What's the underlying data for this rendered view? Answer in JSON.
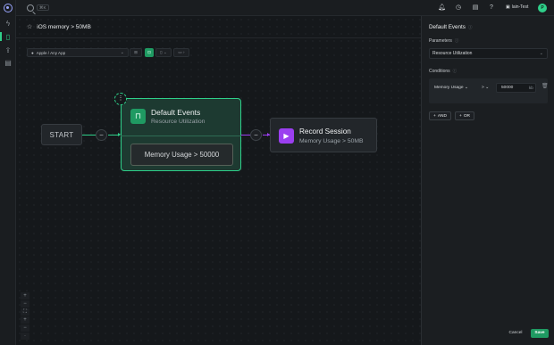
{
  "topbar": {
    "shortcut": "⌘K",
    "user_name": "lain-Test",
    "avatar_initial": "P",
    "icons": [
      "bell-icon",
      "clock-icon",
      "book-icon",
      "help-icon",
      "folder-icon"
    ]
  },
  "rail": {
    "items": [
      "lightning-icon",
      "device-icon",
      "upload-icon",
      "archive-icon"
    ],
    "active": "device-icon"
  },
  "header": {
    "title": "iOS memory > 50MB"
  },
  "toolbar": {
    "platform_label": "Apple / Any App",
    "tool_icons": [
      "grid-icon",
      "code-icon",
      "device-toggle-icon",
      "video-icon"
    ]
  },
  "flow": {
    "start_label": "START",
    "menu_label": "⋮",
    "default_node": {
      "title": "Default Events",
      "subtitle": "Resource Utilization",
      "condition": "Memory Usage > 50000"
    },
    "record_node": {
      "title": "Record Session",
      "subtitle": "Memory Usage > 50MB"
    },
    "connector_symbol": "−"
  },
  "zoom": {
    "controls": [
      "+",
      "−",
      "⛶",
      "+",
      "−",
      "·"
    ]
  },
  "panel": {
    "title": "Default Events",
    "parameters_label": "Parameters",
    "parameters_value": "Resource Utilization",
    "conditions_label": "Conditions",
    "condition": {
      "metric": "Memory Usage",
      "operator": ">",
      "value": "50000",
      "unit": "kb"
    },
    "and_label": "AND",
    "or_label": "OR",
    "cancel_label": "Cancel",
    "save_label": "Save"
  },
  "colors": {
    "accent_green": "#2fd08a",
    "record_purple": "#9b3ff0",
    "background": "#15181b"
  }
}
